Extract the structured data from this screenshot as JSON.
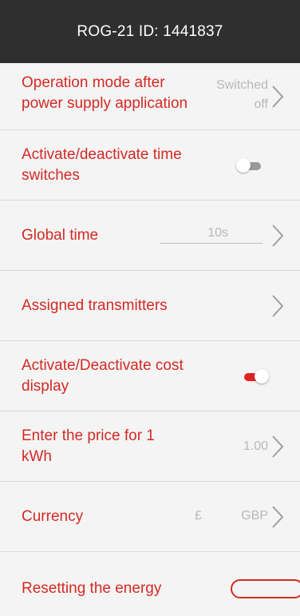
{
  "header": {
    "title": "ROG-21 ID: 1441837"
  },
  "rows": {
    "operation_mode": {
      "label": "Operation mode after power supply application",
      "value": "Switched off"
    },
    "time_switches": {
      "label": "Activate/deactivate time switches",
      "enabled": false
    },
    "global_time": {
      "label": "Global time",
      "value": "10s"
    },
    "assigned_transmitters": {
      "label": "Assigned transmitters"
    },
    "cost_display": {
      "label": "Activate/Deactivate cost display",
      "enabled": true
    },
    "price": {
      "label": "Enter the price for 1 kWh",
      "value": "1.00"
    },
    "currency": {
      "label": "Currency",
      "symbol": "£",
      "value": "GBP"
    },
    "reset_energy": {
      "label": "Resetting the energy"
    }
  },
  "colors": {
    "header_bg": "#2f2f2f",
    "accent": "#d32a24",
    "value_gray": "#b8b8b8",
    "toggle_off_track": "#9a9a9a"
  }
}
